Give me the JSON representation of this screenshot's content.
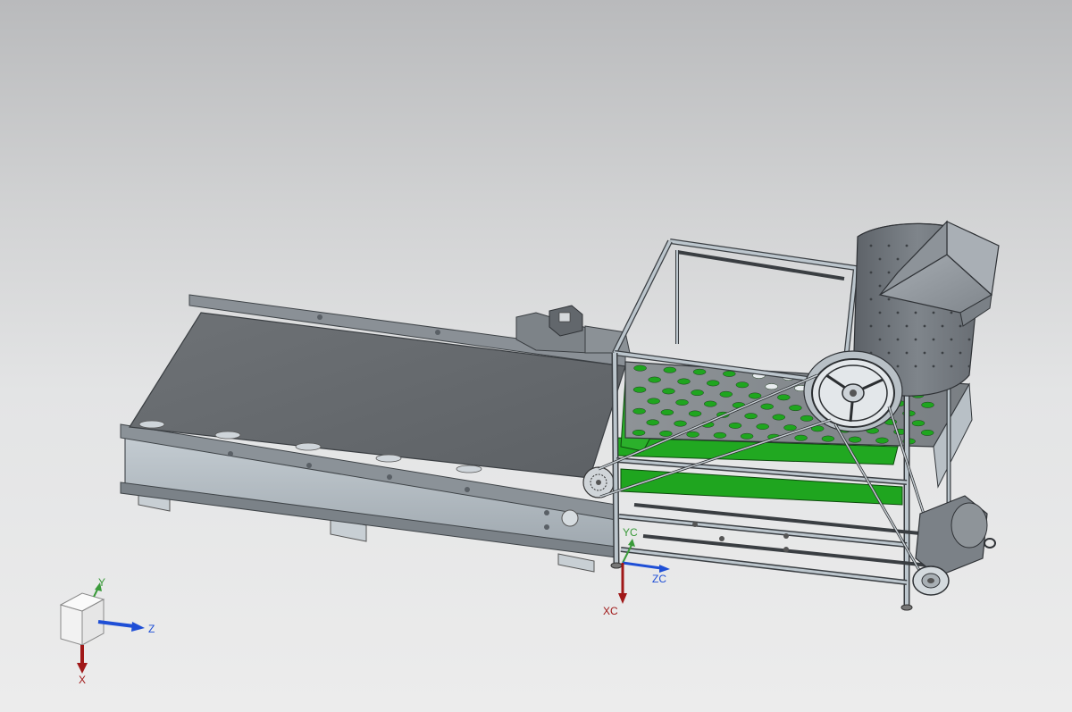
{
  "viewport": {
    "background_top": "#b9babc",
    "background_bottom": "#ececec"
  },
  "model": {
    "parts": [
      "conveyor-belt",
      "motor",
      "frame",
      "perforated-screen",
      "drum",
      "hopper",
      "pulley",
      "drive-belt",
      "drive-motor"
    ],
    "highlight_color": "#1fa51f",
    "metal_color": "#7a7f84"
  },
  "wcs_triad": {
    "y_label": "Y",
    "z_label": "Z",
    "x_label": "X",
    "y_color": "#3a9a3a",
    "z_color": "#1f4fd6",
    "x_color": "#a01818"
  },
  "csys_triad": {
    "yc_label": "YC",
    "zc_label": "ZC",
    "xc_label": "XC"
  }
}
